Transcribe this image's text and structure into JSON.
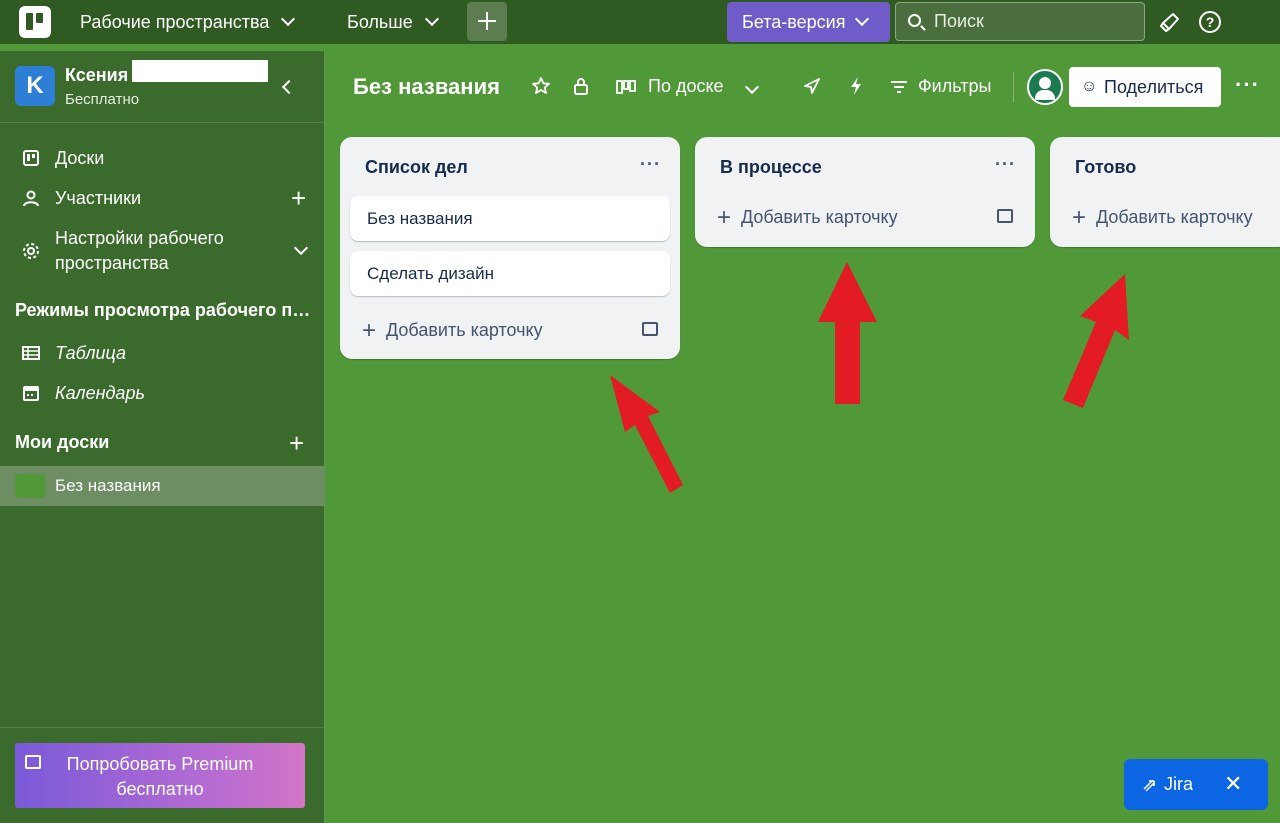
{
  "topbar": {
    "workspaces_label": "Рабочие пространства",
    "more_label": "Больше",
    "beta_label": "Бета-версия",
    "search_placeholder": "Поиск"
  },
  "sidebar": {
    "workspace_initial": "K",
    "workspace_name": "Ксения",
    "workspace_plan": "Бесплатно",
    "nav": [
      {
        "label": "Доски",
        "icon": "board-icon"
      },
      {
        "label": "Участники",
        "icon": "person-icon"
      },
      {
        "label": "Настройки рабочего пространства",
        "icon": "gear-icon"
      }
    ],
    "views_section_title": "Режимы просмотра рабочего пр...",
    "views": [
      {
        "label": "Таблица",
        "icon": "table-icon"
      },
      {
        "label": "Календарь",
        "icon": "calendar-icon"
      }
    ],
    "my_boards_title": "Мои доски",
    "boards": [
      {
        "label": "Без названия",
        "color": "#519839"
      }
    ],
    "premium_label": "Попробовать Premium бесплатно"
  },
  "board": {
    "title": "Без названия",
    "view_label": "По доске",
    "filters_label": "Фильтры",
    "share_label": "Поделиться",
    "background_color": "#519839"
  },
  "lists": [
    {
      "title": "Список дел",
      "cards": [
        "Без названия",
        "Сделать дизайн"
      ],
      "add_label": "Добавить карточку"
    },
    {
      "title": "В процессе",
      "cards": [],
      "add_label": "Добавить карточку"
    },
    {
      "title": "Готово",
      "cards": [],
      "add_label": "Добавить карточку"
    }
  ],
  "jira": {
    "label": "Jira"
  },
  "colors": {
    "topbar": "#2f5a22",
    "sidebar": "#3b6b2c",
    "beta": "#6f5cc9",
    "arrow": "#e31b23",
    "jira": "#0c66e4"
  }
}
